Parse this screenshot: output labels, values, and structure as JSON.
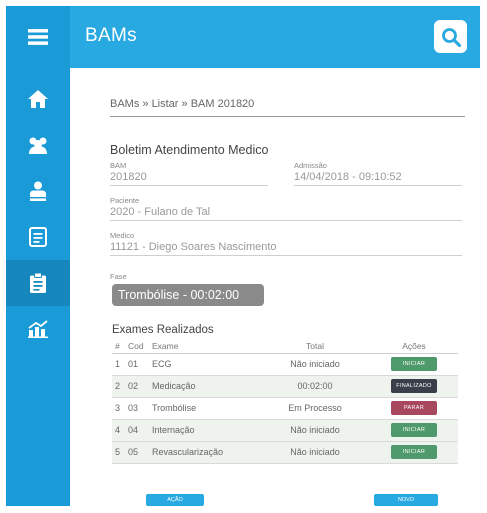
{
  "app": {
    "title": "BAMs"
  },
  "breadcrumb": "BAMs » Listar » BAM 201820",
  "form": {
    "title": "Boletim Atendimento Medico",
    "bam": {
      "label": "BAM",
      "value": "201820"
    },
    "admissao": {
      "label": "Admissão",
      "value": "14/04/2018  -  09:10:52"
    },
    "paciente": {
      "label": "Paciente",
      "value": "2020 - Fulano de Tal"
    },
    "medico": {
      "label": "Medico",
      "value": "11121 - Diego Soares Nascimento"
    },
    "fase": {
      "label": "Fase",
      "value": "Trombólise - 00:02:00"
    }
  },
  "exams": {
    "title": "Exames Realizados",
    "headers": {
      "idx": "#",
      "cod": "Cod",
      "exame": "Exame",
      "total": "Total",
      "acoes": "Ações"
    },
    "rows": [
      {
        "idx": "1",
        "cod": "01",
        "exame": "ECG",
        "total": "Não iniciado",
        "action": "INICIAR",
        "action_color": "#4e9a6c"
      },
      {
        "idx": "2",
        "cod": "02",
        "exame": "Medicação",
        "total": "00:02:00",
        "action": "FINALIZADO",
        "action_color": "#3b3f4a"
      },
      {
        "idx": "3",
        "cod": "03",
        "exame": "Trombólise",
        "total": "Em Processo",
        "action": "PARAR",
        "action_color": "#a8485e"
      },
      {
        "idx": "4",
        "cod": "04",
        "exame": "Internação",
        "total": "Não iniciado",
        "action": "INICIAR",
        "action_color": "#4e9a6c"
      },
      {
        "idx": "5",
        "cod": "05",
        "exame": "Revascularização",
        "total": "Não iniciado",
        "action": "INICIAR",
        "action_color": "#4e9a6c"
      }
    ]
  },
  "footer": {
    "left_button": "AÇÃO",
    "right_button": "NOVO"
  },
  "sidebar": {
    "items": [
      {
        "icon": "menu-icon"
      },
      {
        "icon": "home-icon"
      },
      {
        "icon": "users-icon"
      },
      {
        "icon": "person-icon"
      },
      {
        "icon": "document-icon"
      },
      {
        "icon": "clipboard-icon",
        "active": true
      },
      {
        "icon": "chart-icon"
      }
    ]
  },
  "colors": {
    "sidebar": "#1a9ad6",
    "topbar": "#29a9e1",
    "fase_badge": "#8a8a8a",
    "accent": "#29a9e1"
  }
}
